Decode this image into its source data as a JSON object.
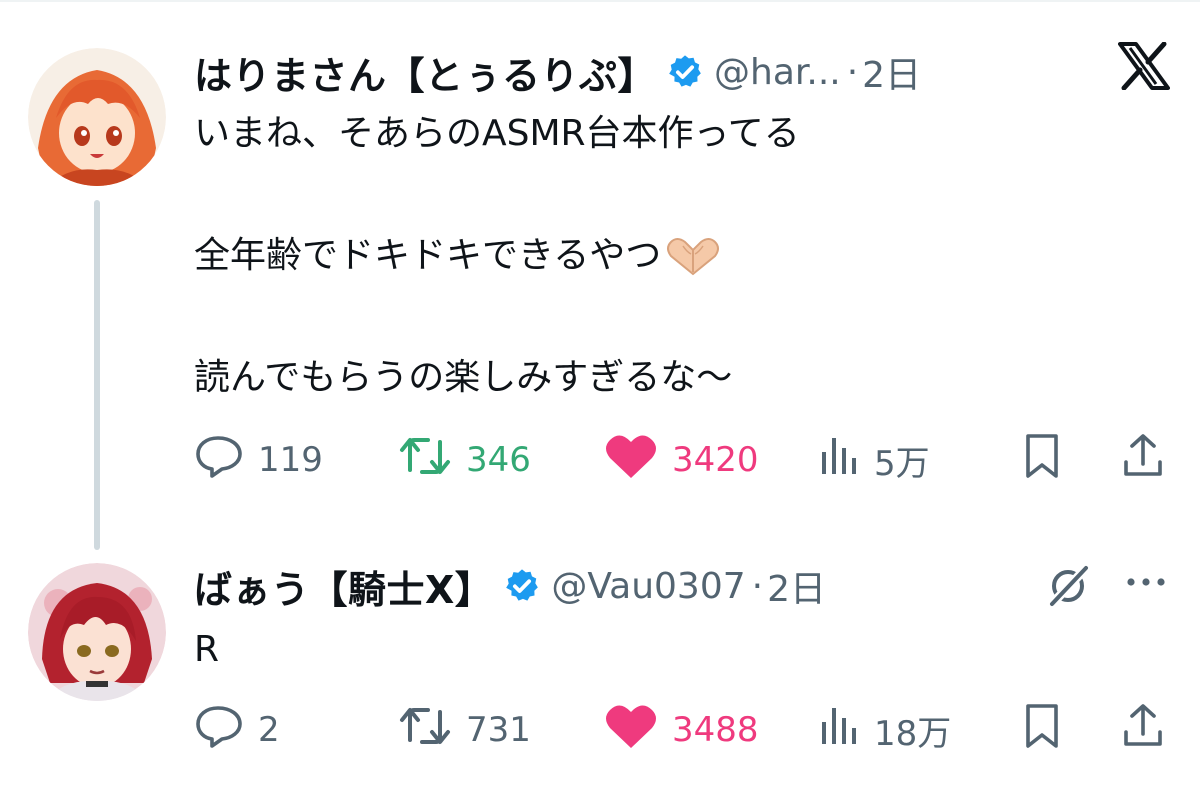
{
  "post": {
    "name": "はりまさん【とぅるりぷ】",
    "handle": "@har...",
    "time": "2日",
    "text_line1": "いまね、そあらのASMR台本作ってる",
    "text_line2": "全年齢でドキドキできるやつ",
    "text_line3": "読んでもらうの楽しみすぎるな〜",
    "replies": "119",
    "reposts": "346",
    "likes": "3420",
    "views": "5万"
  },
  "reply": {
    "name": "ばぁう【騎士X】",
    "handle": "@Vau0307",
    "time": "2日",
    "text": "R",
    "replies": "2",
    "reposts": "731",
    "likes": "3488",
    "views": "18万"
  },
  "separator": "·",
  "colors": {
    "verified": "#1d9bf0",
    "repost_active": "#33a874",
    "like_active": "#ef3a7e",
    "muted": "#536471"
  },
  "icons": [
    "x-logo-icon",
    "verified-badge-icon",
    "reply-icon",
    "repost-icon",
    "heart-icon",
    "views-icon",
    "bookmark-icon",
    "share-icon",
    "grok-icon",
    "more-icon",
    "heart-hands-emoji"
  ]
}
